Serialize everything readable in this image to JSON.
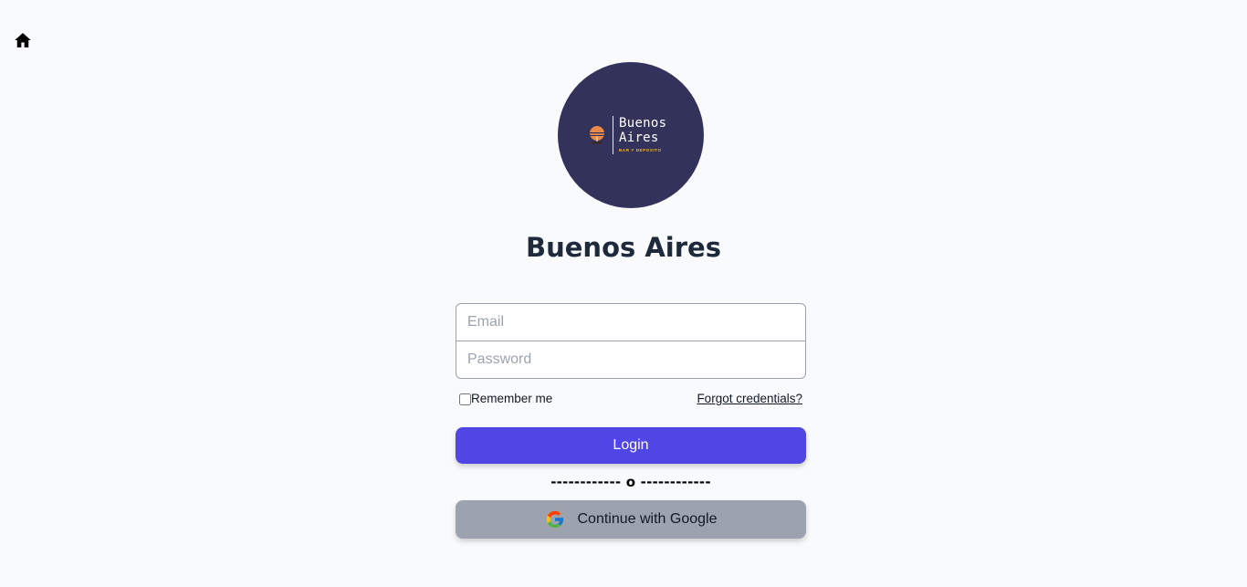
{
  "nav": {
    "home_icon": "home-icon"
  },
  "logo": {
    "name": "Buenos\nAires",
    "tagline": "BAR Y DEPOSITO",
    "background": "#32325a",
    "tagline_color": "#f2b632"
  },
  "title": "Buenos Aires",
  "form": {
    "email_placeholder": "Email",
    "password_placeholder": "Password",
    "remember_label": "Remember me",
    "forgot_label": "Forgot credentials?",
    "login_label": "Login",
    "separator": "------------ o ------------",
    "google_label": "Continue with Google",
    "google_icon": "google-icon"
  },
  "colors": {
    "page_background": "#f8fafc",
    "primary": "#4f46e5",
    "google_button": "#9ca3af",
    "title": "#1e293b"
  }
}
